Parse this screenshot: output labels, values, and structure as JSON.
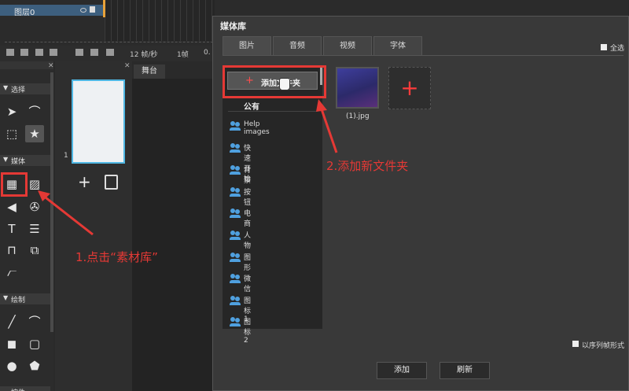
{
  "timeline": {
    "layer_name": "图层0",
    "fps_label": "12 帧/秒",
    "frame_label": "1帧",
    "time_label": "0."
  },
  "left_panel": {
    "sections": {
      "select": "选择",
      "media": "媒体",
      "draw": "绘制",
      "bottom_cut": "控件"
    }
  },
  "pages": {
    "page_number": "1"
  },
  "stage": {
    "tab_label": "舞台"
  },
  "dialog": {
    "title": "媒体库",
    "tabs": [
      "图片",
      "音频",
      "视频",
      "字体"
    ],
    "select_all": "全选",
    "add_folder": "添加文件夹",
    "public_label": "公有",
    "folders": [
      "Help images",
      "快速开始",
      "背景",
      "按钮",
      "电商",
      "人物",
      "图形",
      "微信",
      "图标1",
      "图标2"
    ],
    "media_items": [
      {
        "name": "(1).jpg"
      }
    ],
    "sequence_option": "以序列帧形式",
    "buttons": {
      "add": "添加",
      "refresh": "刷新"
    }
  },
  "annotations": {
    "step1": "1.点击“素材库”",
    "step2": "2.添加新文件夹"
  },
  "colors": {
    "accent_red": "#e53935",
    "highlight_blue": "#4fb7e3",
    "user_icon": "#4fa0df"
  }
}
